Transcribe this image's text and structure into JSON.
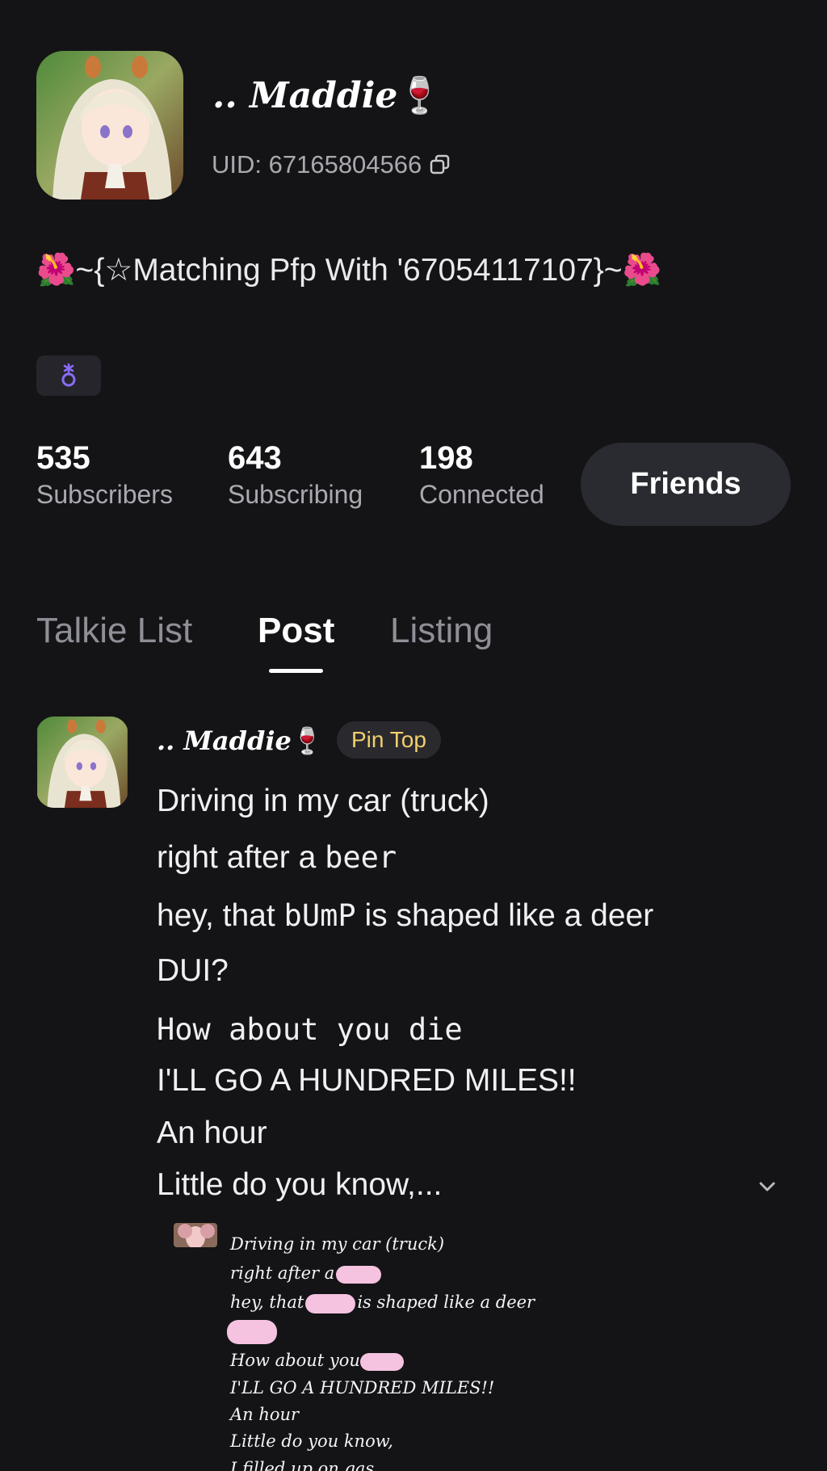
{
  "profile": {
    "display_name": ".. Maddie",
    "name_emoji": "🍷",
    "uid_label": "UID: 67165804566",
    "bio": "🌺~{☆Matching Pfp With '67054117107}~🌺",
    "gender_icon": "male-symbol-icon"
  },
  "stats": [
    {
      "value": "535",
      "label": "Subscribers"
    },
    {
      "value": "643",
      "label": "Subscribing"
    },
    {
      "value": "198",
      "label": "Connected"
    }
  ],
  "friends_button": "Friends",
  "tabs": [
    {
      "label": "Talkie List",
      "active": false
    },
    {
      "label": "Post",
      "active": true
    },
    {
      "label": "Listing",
      "active": false
    }
  ],
  "post": {
    "author": ".. Maddie",
    "author_emoji": "🍷",
    "pin_label": "Pin Top",
    "lines": {
      "l1": "Driving in my car (truck)",
      "l2a": "right after a ",
      "l2b": "beer",
      "l3a": "hey, that ",
      "l3b": "bUmP",
      "l3c": " is shaped like a deer",
      "l4": "DUI?",
      "l5": "How about you die",
      "l6": "I'LL GO A HUNDRED MILES!!",
      "l7": "An hour",
      "l8": "Little do you know,..."
    },
    "image_lines": {
      "i1": "Driving in my car (truck)",
      "i2": "right after a",
      "i3a": "hey, that",
      "i3b": "is shaped like a deer",
      "i5": "How about you",
      "i6": "I'LL GO A HUNDRED MILES!!",
      "i7": "An hour",
      "i8": "Little do you know,",
      "i9": "I filled up on gas"
    }
  },
  "colors": {
    "background": "#141417",
    "pin_text": "#f1cf6d",
    "friends_bg": "#2a2b30",
    "gender_icon": "#8b6cf6"
  }
}
